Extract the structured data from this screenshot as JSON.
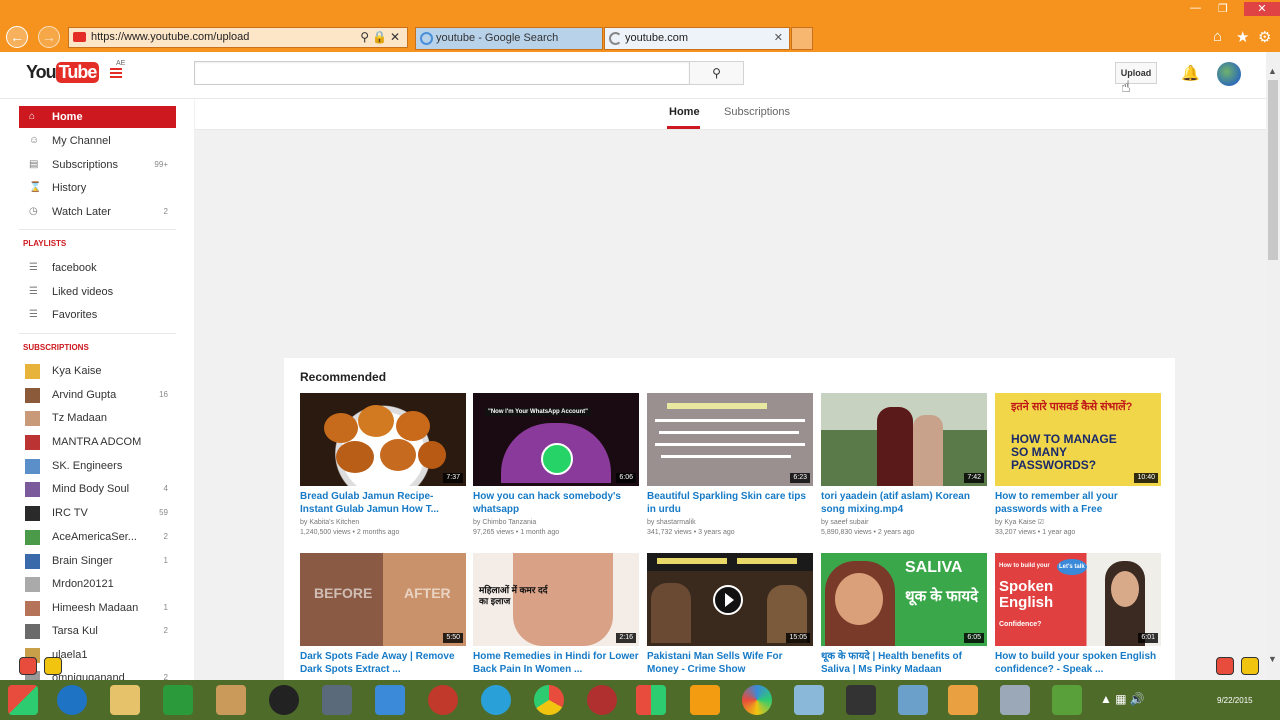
{
  "browser": {
    "address": "https://www.youtube.com/upload",
    "tabs": [
      {
        "label": "youtube - Google Search"
      },
      {
        "label": "youtube.com"
      }
    ]
  },
  "header": {
    "logo_you": "You",
    "logo_tube": "Tube",
    "logo_region": "AE",
    "upload_label": "Upload"
  },
  "feed_tabs": [
    "Home",
    "Subscriptions"
  ],
  "sidebar": {
    "main": [
      {
        "label": "Home",
        "icon": "home-icon"
      },
      {
        "label": "My Channel",
        "icon": "person-icon"
      },
      {
        "label": "Subscriptions",
        "icon": "subscriptions-icon",
        "count": "99+"
      },
      {
        "label": "History",
        "icon": "history-icon"
      },
      {
        "label": "Watch Later",
        "icon": "clock-icon",
        "count": "2"
      }
    ],
    "playlists_heading": "PLAYLISTS",
    "playlists": [
      {
        "label": "facebook"
      },
      {
        "label": "Liked videos"
      },
      {
        "label": "Favorites"
      }
    ],
    "subscriptions_heading": "SUBSCRIPTIONS",
    "subscriptions": [
      {
        "label": "Kya Kaise",
        "count": ""
      },
      {
        "label": "Arvind Gupta",
        "count": "16"
      },
      {
        "label": "Tz Madaan",
        "count": ""
      },
      {
        "label": "MANTRA ADCOM",
        "count": ""
      },
      {
        "label": "SK. Engineers",
        "count": ""
      },
      {
        "label": "Mind Body Soul",
        "count": "4"
      },
      {
        "label": "IRC TV",
        "count": "59"
      },
      {
        "label": "AceAmericaSer...",
        "count": "2"
      },
      {
        "label": "Brain Singer",
        "count": "1"
      },
      {
        "label": "Mrdon20121",
        "count": ""
      },
      {
        "label": "Himeesh Madaan",
        "count": "1"
      },
      {
        "label": "Tarsa Kul",
        "count": "2"
      },
      {
        "label": "ulaela1",
        "count": ""
      },
      {
        "label": "omniguganand",
        "count": "2"
      }
    ]
  },
  "recommended": {
    "heading": "Recommended",
    "videos": [
      {
        "title": "Bread Gulab Jamun Recipe- Instant Gulab Jamun How T...",
        "by": "by Kabita's Kitchen",
        "meta": "1,240,500 views • 2 months ago",
        "duration": "7:37"
      },
      {
        "title": "How you can hack somebody's whatsapp",
        "by": "by Chimbo Tanzania",
        "meta": "97,265 views • 1 month ago",
        "duration": "6:06",
        "thumb_text": "\"Now I'm Your WhatsApp Account\""
      },
      {
        "title": "Beautiful Sparkling Skin care tips in urdu",
        "by": "by shastarmalik",
        "meta": "341,732 views • 3 years ago",
        "duration": "6:23"
      },
      {
        "title": "tori yaadein (atif aslam) Korean song mixing.mp4",
        "by": "by saeef subair",
        "meta": "5,890,830 views • 2 years ago",
        "duration": "7:42"
      },
      {
        "title": "How to remember all your passwords with a Free",
        "by": "by Kya Kaise ☑",
        "meta": "33,207 views • 1 year ago",
        "duration": "10:40",
        "thumb_text_hi": "इतने सारे पासवर्ड कैसे संभालें?",
        "thumb_text_en": "HOW TO MANAGE SO MANY PASSWORDS?"
      },
      {
        "title": "Dark Spots Fade Away | Remove Dark Spots Extract ...",
        "by": "",
        "meta": "",
        "duration": "5:50",
        "thumb_before": "BEFORE",
        "thumb_after": "AFTER"
      },
      {
        "title": "Home Remedies in Hindi for Lower Back Pain In Women ...",
        "by": "",
        "meta": "",
        "duration": "2:16",
        "thumb_text": "महिलाओं में कमर दर्द का इलाज"
      },
      {
        "title": "Pakistani Man Sells Wife For Money - Crime Show",
        "by": "",
        "meta": "",
        "duration": "15:05"
      },
      {
        "title": "थूक के फायदे | Health benefits of Saliva | Ms Pinky Madaan",
        "by": "",
        "meta": "",
        "duration": "6:05",
        "thumb_saliva": "SALIVA",
        "thumb_hi": "थूक के फायदे"
      },
      {
        "title": "How to build your spoken English confidence? - Speak ...",
        "by": "",
        "meta": "",
        "duration": "6:01",
        "thumb_text": "Spoken English",
        "thumb_small": "How to build your",
        "thumb_small2": "Confidence?",
        "thumb_badge": "Let's talk"
      }
    ]
  },
  "taskbar": {
    "date": "9/22/2015"
  },
  "colors": {
    "browser_chrome": "#f5931e",
    "youtube_red": "#cc181e",
    "link_blue": "#167ac6",
    "taskbar": "#4f6b2a"
  }
}
